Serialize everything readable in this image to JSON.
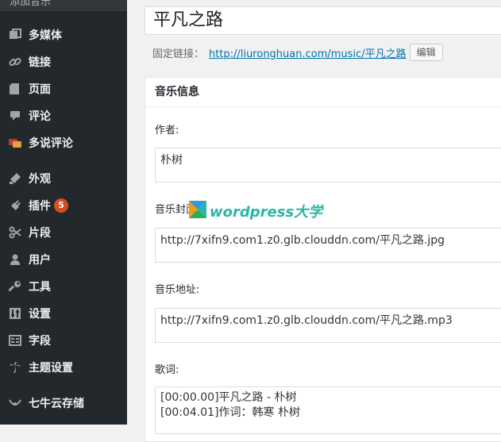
{
  "sidebar": {
    "top_item": "添加音乐",
    "items": [
      {
        "label": "多媒体",
        "icon": "media-icon"
      },
      {
        "label": "链接",
        "icon": "link-icon"
      },
      {
        "label": "页面",
        "icon": "page-icon"
      },
      {
        "label": "评论",
        "icon": "comment-icon"
      },
      {
        "label": "多说评论",
        "icon": "duoshuo-icon"
      },
      {
        "label": "外观",
        "icon": "appearance-icon"
      },
      {
        "label": "插件",
        "icon": "plugin-icon",
        "badge": "5"
      },
      {
        "label": "片段",
        "icon": "scissors-icon"
      },
      {
        "label": "用户",
        "icon": "user-icon"
      },
      {
        "label": "工具",
        "icon": "wrench-icon"
      },
      {
        "label": "设置",
        "icon": "settings-icon"
      },
      {
        "label": "字段",
        "icon": "field-icon"
      },
      {
        "label": "主题设置",
        "icon": "palm-icon"
      },
      {
        "label": "七牛云存储",
        "icon": "qiniu-icon"
      }
    ]
  },
  "post": {
    "title": "平凡之路",
    "permalink_label": "固定链接：",
    "permalink_url": "http://liuronghuan.com/music/平凡之路",
    "edit_label": "编辑"
  },
  "metabox": {
    "title": "音乐信息",
    "author_label": "作者:",
    "author_value": "朴树",
    "cover_label": "音乐封面:",
    "cover_value": "http://7xifn9.com1.z0.glb.clouddn.com/平凡之路.jpg",
    "url_label": "音乐地址:",
    "url_value": "http://7xifn9.com1.z0.glb.clouddn.com/平凡之路.mp3",
    "lyrics_label": "歌词:",
    "lyrics_line1": "[00:00.00]平凡之路 - 朴树",
    "lyrics_line2": "[00:04.01]作词：韩寒 朴树"
  },
  "watermark": {
    "text": "wordpress大学"
  }
}
